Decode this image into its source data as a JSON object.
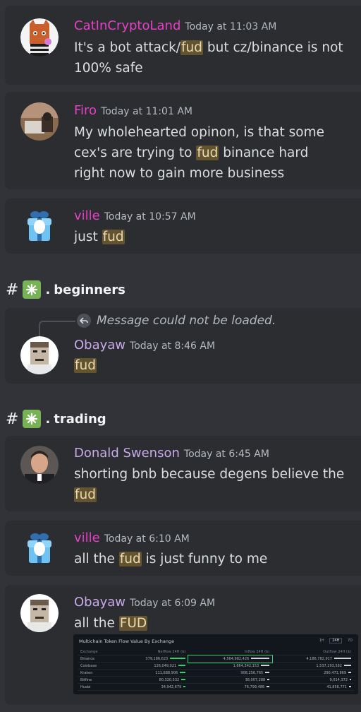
{
  "messages": [
    {
      "user": "CatInCryptoLand",
      "time": "Today at 11:03 AM",
      "text_before": "It's a bot attack/",
      "highlight": "fud",
      "text_after": " but cz/binance is not 100% safe",
      "name_color": "#e740c8"
    },
    {
      "user": "Firo",
      "time": "Today at 11:01 AM",
      "text_before": "My wholehearted opinon, is that some cex's are trying to ",
      "highlight": "fud",
      "text_after": " binance hard right now to gain more business",
      "name_color": "#e740c8"
    },
    {
      "user": "ville",
      "time": "Today at 10:57 AM",
      "text_before": "just ",
      "highlight": "fud",
      "text_after": "",
      "name_color": "#e740c8"
    },
    {
      "user": "Obayaw",
      "time": "Today at 8:46 AM",
      "text_before": "",
      "highlight": "fud",
      "text_after": "",
      "name_color": "#c9a9e9",
      "reply_text": "Message could not be loaded."
    },
    {
      "user": "Donald Swenson",
      "time": "Today at 6:45 AM",
      "text_before": "shorting bnb because degens believe the ",
      "highlight": "fud",
      "text_after": "",
      "name_color": "#c9a9e9"
    },
    {
      "user": "ville",
      "time": "Today at 6:10 AM",
      "text_before": "all the ",
      "highlight": "fud",
      "text_after": " is just funny to me",
      "name_color": "#e740c8"
    },
    {
      "user": "Obayaw",
      "time": "Today at 6:09 AM",
      "text_before": "all the ",
      "highlight": "FUD",
      "text_after": "",
      "name_color": "#c9a9e9"
    }
  ],
  "channels": [
    {
      "name": "beginners",
      "prefix": "#",
      "separator": "."
    },
    {
      "name": "trading",
      "prefix": "#",
      "separator": "."
    }
  ],
  "embed": {
    "title": "Multichain Token Flow Value By Exchange",
    "tabs": [
      "1H",
      "24H",
      "7D"
    ],
    "active_tab": "24H",
    "columns": [
      "Exchange",
      "Netflow 24H ($)",
      "Inflow 24H ($)",
      "Outflow 24H ($)"
    ],
    "rows": [
      [
        "Binance",
        "379,186,623",
        "4,564,982,426",
        "4,186,782,917"
      ],
      [
        "Coinbase",
        "126,049,021",
        "1,664,342,153",
        "1,537,293,582"
      ],
      [
        "Kraken",
        "111,688,906",
        "908,256,765",
        "290,471,869"
      ],
      [
        "Bitfine",
        "80,320,532",
        "38,007,288",
        "9,014,372"
      ],
      [
        "Huobi",
        "34,942,679",
        "76,799,486",
        "41,856,771"
      ]
    ]
  },
  "colors": {
    "background": "#313338",
    "card": "#2b2d31",
    "highlight_bg": "#64532f",
    "accent_green": "#2fd16b"
  },
  "icons": {
    "reply": "reply-arrow-icon",
    "channel_emoji": "sparkle-icon"
  }
}
